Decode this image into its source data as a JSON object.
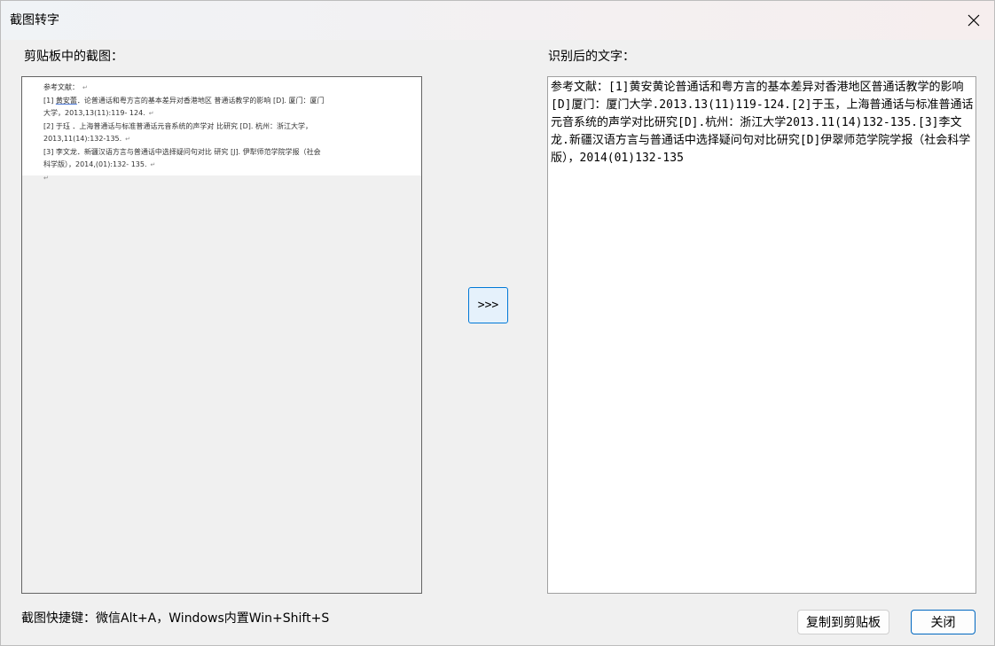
{
  "window": {
    "title": "截图转字",
    "close_glyph": "✕"
  },
  "left_pane": {
    "label": "剪贴板中的截图：",
    "clipboard_lines": [
      {
        "text": "参考文献：",
        "mark": "↵"
      },
      {
        "prefix": "[1] ",
        "underlined": "黄安蕾",
        "rest": "．论普通话和粤方言的基本差异对香港地区 普通话教学的影响 [D]. 厦门：厦门",
        "mark": ""
      },
      {
        "text": "大学，2013,13(11):119- 124.",
        "mark": "↵"
      },
      {
        "text": "[2] 于珏 ．上海普通话与标准普通话元音系统的声学对  比研究 [D]. 杭州：浙江大学，",
        "mark": ""
      },
      {
        "text": "2013,11(14):132-135.",
        "mark": "↵"
      },
      {
        "text": "[3] 李文龙．新疆汉语方言与普通话中选择疑问句对比  研究 [J]. 伊犁师范学院学报（社会",
        "mark": ""
      },
      {
        "text": "科学版），2014,(01):132- 135.",
        "mark": "↵"
      },
      {
        "text": "",
        "mark": "↵"
      }
    ]
  },
  "convert_button": {
    "label": ">>>"
  },
  "right_pane": {
    "label": "识别后的文字：",
    "recognized_text": "参考文献：[1]黄安黄论普通话和粤方言的基本差异对香港地区普通话教学的影响[D]厦门：厦门大学.2013.13(11)119-124.[2]于玉，上海普通话与标准普通话元音系统的声学对比研究[D].杭州：浙江大学2013.11(14)132-135.[3]李文龙.新疆汉语方言与普通话中选择疑问句对比研究[D]伊翠师范学院学报（社会科学版），2014(01)132-135"
  },
  "footer": {
    "hint": "截图快捷键：微信Alt+A，Windows内置Win+Shift+S",
    "copy_button": "复制到剪贴板",
    "close_button": "关闭"
  }
}
